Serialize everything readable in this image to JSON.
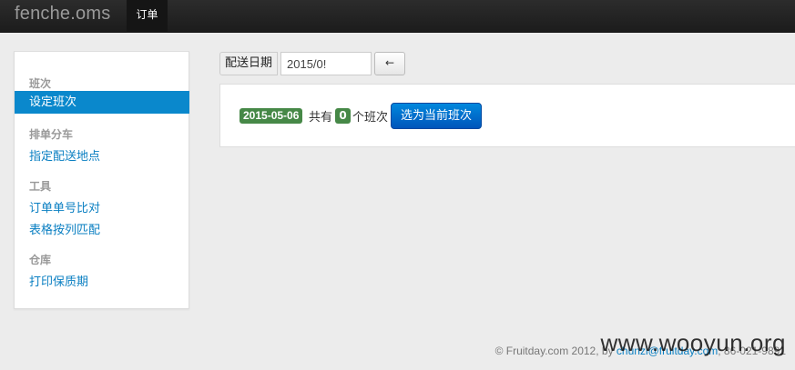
{
  "navbar": {
    "brand": "fenche.oms",
    "tabs": [
      {
        "label": "订单",
        "active": true
      }
    ]
  },
  "sidebar": {
    "sections": [
      {
        "header": "班次",
        "items": [
          {
            "label": "设定班次",
            "active": true
          }
        ]
      },
      {
        "header": "排单分车",
        "items": [
          {
            "label": "指定配送地点"
          }
        ]
      },
      {
        "header": "工具",
        "items": [
          {
            "label": "订单单号比对"
          },
          {
            "label": "表格按列匹配"
          }
        ]
      },
      {
        "header": "仓库",
        "items": [
          {
            "label": "打印保质期"
          }
        ]
      }
    ]
  },
  "filter": {
    "date_label": "配送日期",
    "date_value": "2015/0!",
    "arrow_label": "←"
  },
  "result": {
    "date_badge": "2015-05-06",
    "text_total": "共有",
    "count_badge": "0",
    "text_unit": "个班次",
    "select_button": "选为当前班次"
  },
  "footer": {
    "copyright": "© Fruitday.com 2012, by",
    "email": "chunzi@fruitday.com",
    "phone": ", 86-021-9891"
  },
  "watermark": "www.wooyun.org",
  "colors": {
    "navbar_bg": "#1c1c1c",
    "accent": "#0a88cc",
    "badge_green": "#468847",
    "link": "#0a7fc2"
  }
}
